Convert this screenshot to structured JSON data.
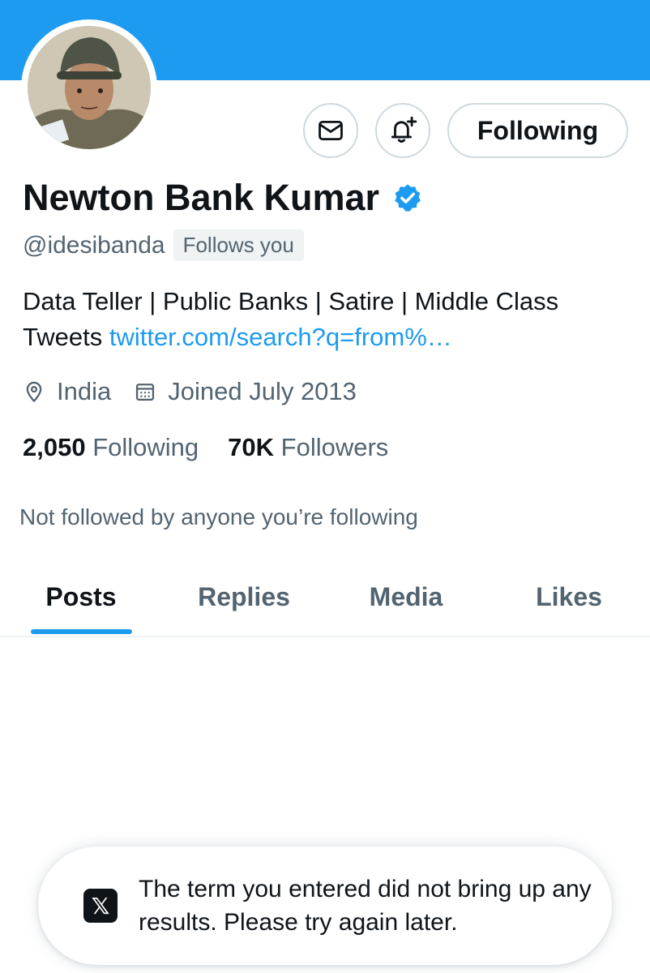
{
  "theme": {
    "accent": "#1d9bf0",
    "text": "#0f1419",
    "muted": "#536471",
    "border": "#cfd9de"
  },
  "profile": {
    "name": "Newton Bank Kumar",
    "verified": true,
    "handle": "@idesibanda",
    "follows_you_badge": "Follows you",
    "bio_text": "Data Teller | Public Banks | Satire | Middle Class Tweets ",
    "bio_link": "twitter.com/search?q=from%…",
    "location": "India",
    "joined": "Joined July 2013",
    "following_count": "2,050",
    "following_label": "Following",
    "followers_count": "70K",
    "followers_label": "Followers",
    "mutuals_note": "Not followed by anyone you’re following"
  },
  "actions": {
    "message_icon": "envelope-icon",
    "notify_icon": "bell-plus-icon",
    "follow_button_label": "Following"
  },
  "tabs": [
    {
      "label": "Posts",
      "active": true
    },
    {
      "label": "Replies",
      "active": false
    },
    {
      "label": "Media",
      "active": false
    },
    {
      "label": "Likes",
      "active": false
    }
  ],
  "toast": {
    "icon": "x-logo-icon",
    "message": "The term you entered did not bring up any results. Please try again later."
  }
}
